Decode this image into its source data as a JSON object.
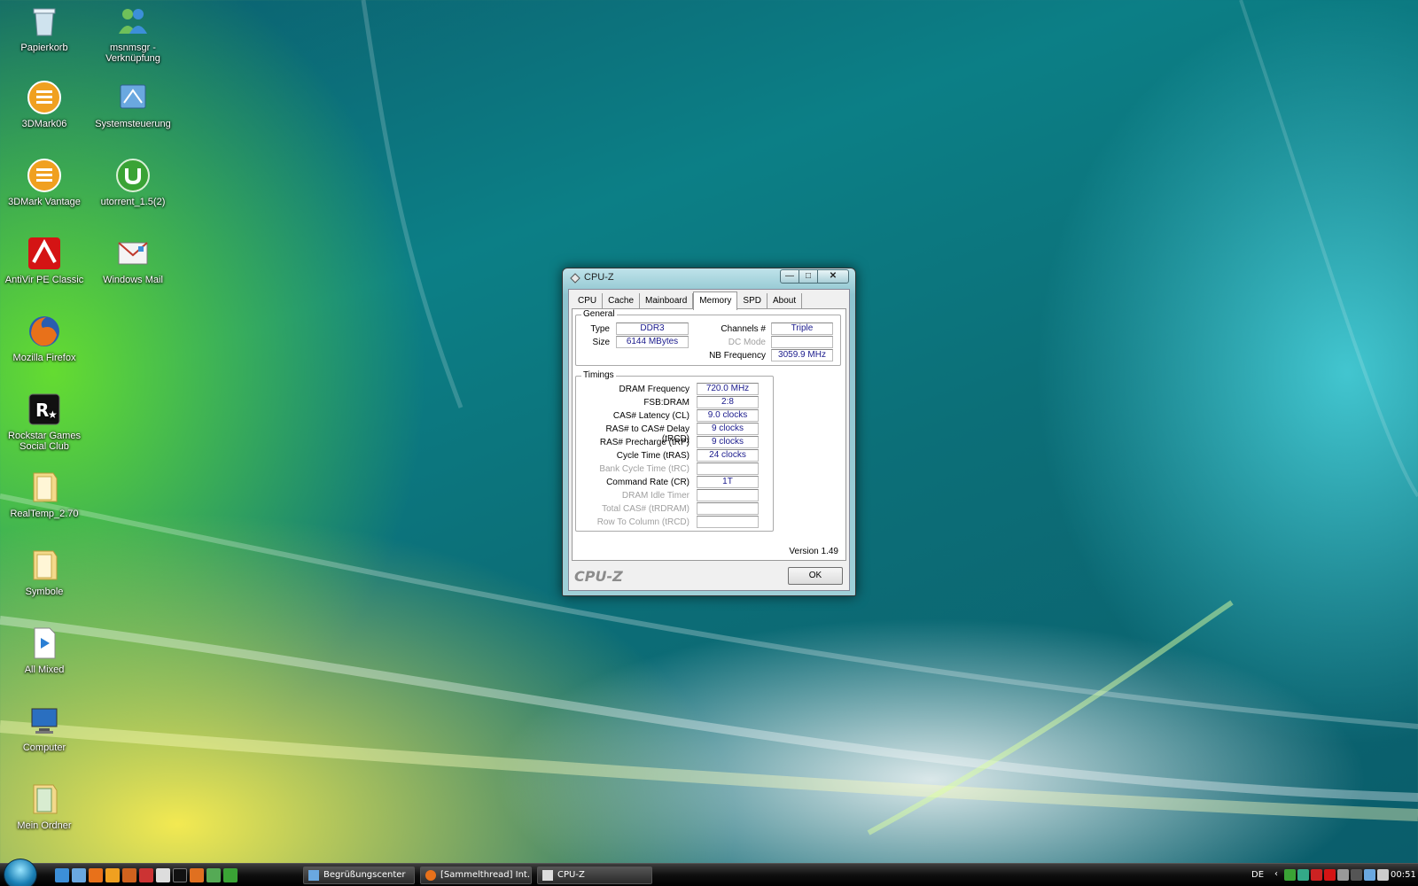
{
  "desktop": {
    "icons": [
      {
        "label": "Papierkorb",
        "icon": "recycle-bin-icon"
      },
      {
        "label": "msnmsgr - Verknüpfung",
        "icon": "msn-messenger-icon"
      },
      {
        "label": "3DMark06",
        "icon": "3dmark-icon"
      },
      {
        "label": "Systemsteuerung",
        "icon": "control-panel-icon"
      },
      {
        "label": "3DMark Vantage",
        "icon": "3dmark-icon"
      },
      {
        "label": "utorrent_1.5(2)",
        "icon": "utorrent-icon"
      },
      {
        "label": "AntiVir PE Classic",
        "icon": "antivir-icon"
      },
      {
        "label": "Windows Mail",
        "icon": "mail-icon"
      },
      {
        "label": "Mozilla Firefox",
        "icon": "firefox-icon"
      },
      {
        "label": "Rockstar Games Social Club",
        "icon": "rockstar-icon"
      },
      {
        "label": "RealTemp_2.70",
        "icon": "folder-icon"
      },
      {
        "label": "Symbole",
        "icon": "folder-icon"
      },
      {
        "label": "All Mixed",
        "icon": "media-file-icon"
      },
      {
        "label": "Computer",
        "icon": "computer-icon"
      },
      {
        "label": "Mein Ordner",
        "icon": "folder-icon"
      }
    ]
  },
  "window": {
    "title": "CPU-Z",
    "caption_min": "—",
    "caption_max": "□",
    "caption_close": "✕",
    "tabs": [
      "CPU",
      "Cache",
      "Mainboard",
      "Memory",
      "SPD",
      "About"
    ],
    "active_tab": "Memory",
    "general": {
      "title": "General",
      "type_label": "Type",
      "type_value": "DDR3",
      "size_label": "Size",
      "size_value": "6144 MBytes",
      "channels_label": "Channels #",
      "channels_value": "Triple",
      "dcmode_label": "DC Mode",
      "dcmode_value": "",
      "nbfreq_label": "NB Frequency",
      "nbfreq_value": "3059.9 MHz"
    },
    "timings": {
      "title": "Timings",
      "rows": [
        {
          "label": "DRAM Frequency",
          "value": "720.0 MHz",
          "enabled": true
        },
        {
          "label": "FSB:DRAM",
          "value": "2:8",
          "enabled": true
        },
        {
          "label": "CAS# Latency (CL)",
          "value": "9.0 clocks",
          "enabled": true
        },
        {
          "label": "RAS# to CAS# Delay (tRCD)",
          "value": "9 clocks",
          "enabled": true
        },
        {
          "label": "RAS# Precharge (tRP)",
          "value": "9 clocks",
          "enabled": true
        },
        {
          "label": "Cycle Time (tRAS)",
          "value": "24 clocks",
          "enabled": true
        },
        {
          "label": "Bank Cycle Time (tRC)",
          "value": "",
          "enabled": false
        },
        {
          "label": "Command Rate (CR)",
          "value": "1T",
          "enabled": true
        },
        {
          "label": "DRAM Idle Timer",
          "value": "",
          "enabled": false
        },
        {
          "label": "Total CAS# (tRDRAM)",
          "value": "",
          "enabled": false
        },
        {
          "label": "Row To Column (tRCD)",
          "value": "",
          "enabled": false
        }
      ]
    },
    "version": "Version 1.49",
    "logo": "CPU-Z",
    "ok_label": "OK"
  },
  "taskbar": {
    "tasks": [
      {
        "label": "Begrüßungscenter",
        "icon": "welcome-center-icon"
      },
      {
        "label": "[Sammelthread] Int...",
        "icon": "firefox-icon"
      },
      {
        "label": "CPU-Z",
        "icon": "cpuz-icon"
      }
    ],
    "language": "DE",
    "clock": "00:51"
  },
  "colors": {
    "value_text": "#1a1a8c",
    "disabled_text": "#a0a0a0",
    "antivir_red": "#d41414",
    "utorrent_green": "#3aa335"
  }
}
